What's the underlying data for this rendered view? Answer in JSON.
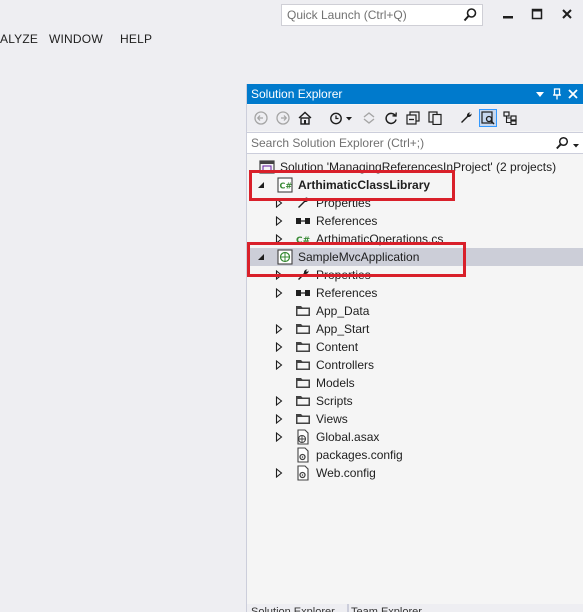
{
  "quick_launch": {
    "placeholder": "Quick Launch (Ctrl+Q)"
  },
  "menu": {
    "items": [
      "ALYZE",
      "WINDOW",
      "HELP"
    ]
  },
  "solution_explorer": {
    "title": "Solution Explorer",
    "search_placeholder": "Search Solution Explorer (Ctrl+;)",
    "tree": [
      {
        "label": "Solution 'ManagingReferencesInProject' (2 projects)",
        "icon": "solution-icon",
        "level": 0,
        "expander": "none"
      },
      {
        "label": "ArthimaticClassLibrary",
        "icon": "csharp-project-icon",
        "level": 0,
        "expander": "expanded",
        "bold": true
      },
      {
        "label": "Properties",
        "icon": "wrench-icon",
        "level": 1,
        "expander": "collapsed"
      },
      {
        "label": "References",
        "icon": "references-icon",
        "level": 1,
        "expander": "collapsed"
      },
      {
        "label": "ArthimaticOperations.cs",
        "icon": "csharp-file-icon",
        "level": 1,
        "expander": "collapsed"
      },
      {
        "label": "SampleMvcApplication",
        "icon": "web-project-icon",
        "level": 0,
        "expander": "expanded",
        "selected": true
      },
      {
        "label": "Properties",
        "icon": "wrench-icon",
        "level": 1,
        "expander": "collapsed"
      },
      {
        "label": "References",
        "icon": "references-icon",
        "level": 1,
        "expander": "collapsed"
      },
      {
        "label": "App_Data",
        "icon": "folder-icon",
        "level": 1,
        "expander": "none"
      },
      {
        "label": "App_Start",
        "icon": "folder-icon",
        "level": 1,
        "expander": "collapsed"
      },
      {
        "label": "Content",
        "icon": "folder-icon",
        "level": 1,
        "expander": "collapsed"
      },
      {
        "label": "Controllers",
        "icon": "folder-icon",
        "level": 1,
        "expander": "collapsed"
      },
      {
        "label": "Models",
        "icon": "folder-icon",
        "level": 1,
        "expander": "none"
      },
      {
        "label": "Scripts",
        "icon": "folder-icon",
        "level": 1,
        "expander": "collapsed"
      },
      {
        "label": "Views",
        "icon": "folder-icon",
        "level": 1,
        "expander": "collapsed"
      },
      {
        "label": "Global.asax",
        "icon": "global-asax-icon",
        "level": 1,
        "expander": "collapsed"
      },
      {
        "label": "packages.config",
        "icon": "config-file-icon",
        "level": 1,
        "expander": "none"
      },
      {
        "label": "Web.config",
        "icon": "config-file-icon",
        "level": 1,
        "expander": "collapsed"
      }
    ],
    "bottom_tabs": [
      "Solution Explorer",
      "Team Explorer"
    ]
  },
  "colors": {
    "accent": "#007acc",
    "highlight_box": "#d9202a",
    "selection": "#ccced8"
  }
}
